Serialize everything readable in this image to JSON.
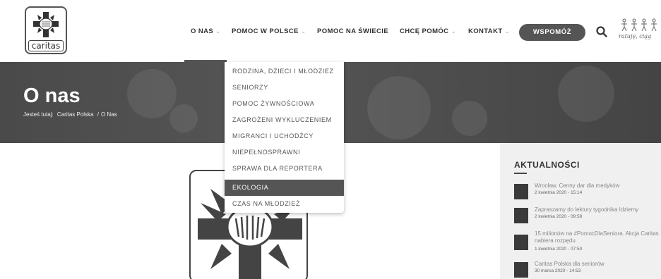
{
  "header": {
    "logo_text": "caritas",
    "nav": [
      {
        "label": "O NAS",
        "has_dropdown": true
      },
      {
        "label": "POMOC W POLSCE",
        "has_dropdown": true
      },
      {
        "label": "POMOC NA ŚWIECIE",
        "has_dropdown": false
      },
      {
        "label": "CHCĘ POMÓC",
        "has_dropdown": true
      },
      {
        "label": "KONTAKT",
        "has_dropdown": true
      }
    ],
    "chevron": "⌄",
    "donate_label": "WSPOMÓŻ",
    "search_icon": "search-icon",
    "ratuje_text": "ratuję, ciąg"
  },
  "hero": {
    "title": "O nas",
    "breadcrumb_prefix": "Jesteś tutaj:",
    "breadcrumb_home": "Caritas Polska",
    "breadcrumb_sep": "/",
    "breadcrumb_current": "O Nas"
  },
  "dropdown": {
    "items": [
      {
        "label": "RODZINA, DZIECI I MŁODZIEZ",
        "active": false
      },
      {
        "label": "SENIORZY",
        "active": false
      },
      {
        "label": "POMOC ŻYWNOŚCIOWA",
        "active": false
      },
      {
        "label": "ZAGROŻENI WYKLUCZENIEM",
        "active": false
      },
      {
        "label": "MIGRANCI I UCHODŹCY",
        "active": false
      },
      {
        "label": "NIEPEŁNOSPRAWNI",
        "active": false
      },
      {
        "label": "SPRAWA DLA REPORTERA",
        "active": false
      },
      {
        "label": "EKOLOGIA",
        "active": true
      },
      {
        "label": "CZAS NA MŁODZIEŻ",
        "active": false
      }
    ]
  },
  "sidebar": {
    "title": "AKTUALNOŚCI",
    "news": [
      {
        "title": "Wrocław. Cenny dar dla medyków",
        "date": "2 kwietnia 2020 - 15:14"
      },
      {
        "title": "Zapraszamy do lektury tygodnika Idziemy",
        "date": "2 kwietnia 2020 - 09:58"
      },
      {
        "title": "15 milionów na #PomocDlaSeniora. Akcja Caritas nabiera rozpędu",
        "date": "1 kwietnia 2020 - 07:50"
      },
      {
        "title": "Caritas Polska dla seniorów",
        "date": "30 marca 2020 - 14:53"
      }
    ]
  },
  "colors": {
    "primary": "#555555",
    "hero_bg": "#4a4a4a",
    "sidebar_bg": "#f0f0f0",
    "white": "#ffffff"
  }
}
